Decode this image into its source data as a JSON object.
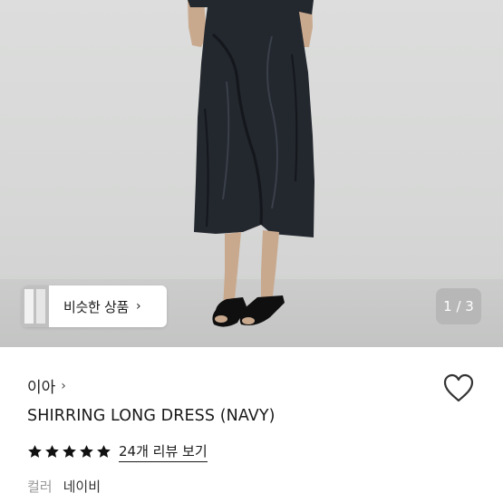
{
  "gallery": {
    "counter": "1 / 3",
    "similar_label": "비슷한 상품",
    "similar_chevron": "›"
  },
  "product": {
    "brand": "이아",
    "brand_chevron": "›",
    "title": "SHIRRING LONG DRESS (NAVY)",
    "rating_stars": 5,
    "review_link": "24개 리뷰 보기",
    "option_key": "컬러",
    "option_value": "네이비"
  },
  "colors": {
    "dress": "#23272e",
    "star": "#111111",
    "heart_stroke": "#333333"
  }
}
